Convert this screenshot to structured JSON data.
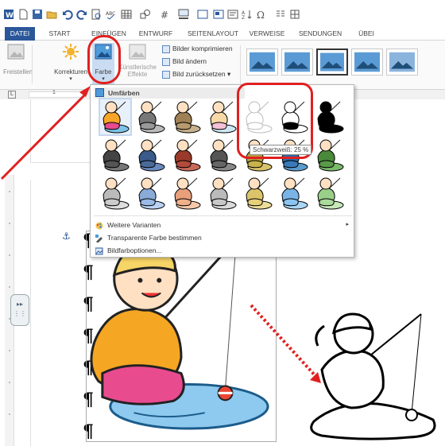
{
  "quick_access": {
    "icons": [
      "word-icon",
      "new-doc-icon",
      "save-icon",
      "open-icon",
      "undo-icon",
      "redo-icon",
      "print-preview-icon",
      "spelling-icon",
      "table-icon",
      "shapes-icon",
      "wordart-icon",
      "border-icon",
      "textbox-icon",
      "text-direction-icon",
      "sort-icon",
      "symbol-icon",
      "columns-icon",
      "position-icon"
    ]
  },
  "tabs": [
    {
      "label": "DATEI"
    },
    {
      "label": "START"
    },
    {
      "label": "EINFÜGEN"
    },
    {
      "label": "ENTWURF"
    },
    {
      "label": "SEITENLAYOUT"
    },
    {
      "label": "VERWEISE"
    },
    {
      "label": "SENDUNGEN"
    },
    {
      "label": "ÜBEI"
    }
  ],
  "ribbon": {
    "freistellen": "Freistellen",
    "korrekturen": "Korrekturen",
    "farbe": "Farbe",
    "kuenstlerische": "Künstlerische",
    "effekte": "Effekte",
    "bilder_komprimieren": "Bilder komprimieren",
    "bild_aendern": "Bild ändern",
    "bild_zuruecksetzen": "Bild zurücksetzen"
  },
  "ruler": {
    "tick_1": "1"
  },
  "dropdown": {
    "header": "Umfärben",
    "tooltip": "Schwarzweiß: 25 %",
    "menu": {
      "weitere": "Weitere Varianten",
      "transparente": "Transparente Farbe bestimmen",
      "optionen": "Bildfarboptionen..."
    },
    "rows": [
      [
        {
          "name": "original",
          "c1": "#f7a529",
          "c2": "#e84a8f",
          "c3": "#7fc2e8"
        },
        {
          "name": "grau",
          "c1": "#777",
          "c2": "#999",
          "c3": "#bbb"
        },
        {
          "name": "sepia",
          "c1": "#a08055",
          "c2": "#b89a70",
          "c3": "#c9b08c"
        },
        {
          "name": "washout",
          "c1": "#f7d9a8",
          "c2": "#f4c1d6",
          "c3": "#cfe7f4"
        },
        {
          "name": "schwarzweiss-25",
          "c1": "#fff",
          "c2": "#fff",
          "c3": "#fff"
        },
        {
          "name": "schwarzweiss-50",
          "c1": "#fff",
          "c2": "#000",
          "c3": "#fff"
        },
        {
          "name": "schwarzweiss-75",
          "c1": "#000",
          "c2": "#000",
          "c3": "#000"
        }
      ],
      [
        {
          "name": "dunkel-grau",
          "c1": "#444",
          "c2": "#555",
          "c3": "#777"
        },
        {
          "name": "dunkel-blau",
          "c1": "#3a5a8a",
          "c2": "#4a6a9a",
          "c3": "#6a8abd"
        },
        {
          "name": "dunkel-rot",
          "c1": "#9a3a2a",
          "c2": "#b44a3a",
          "c3": "#c76a5a"
        },
        {
          "name": "dunkel-grau2",
          "c1": "#555",
          "c2": "#666",
          "c3": "#888"
        },
        {
          "name": "dunkel-gold",
          "c1": "#b8a23a",
          "c2": "#c8b24a",
          "c3": "#d8c26a"
        },
        {
          "name": "dunkel-blau2",
          "c1": "#2a6aaa",
          "c2": "#3a7aba",
          "c3": "#5a9acd"
        },
        {
          "name": "dunkel-gruen",
          "c1": "#4a8a3a",
          "c2": "#5a9a4a",
          "c3": "#7aba6a"
        }
      ],
      [
        {
          "name": "hell-grau",
          "c1": "#bbb",
          "c2": "#ccc",
          "c3": "#ddd"
        },
        {
          "name": "hell-blau",
          "c1": "#8aaad8",
          "c2": "#9abae8",
          "c3": "#bad2f4"
        },
        {
          "name": "hell-orange",
          "c1": "#e8a07a",
          "c2": "#f0b08a",
          "c3": "#f6c8aa"
        },
        {
          "name": "hell-grau2",
          "c1": "#bbb",
          "c2": "#c8c8c8",
          "c3": "#dadada"
        },
        {
          "name": "hell-gold",
          "c1": "#dcc46a",
          "c2": "#e6d07a",
          "c3": "#eedd9a"
        },
        {
          "name": "hell-blau2",
          "c1": "#7ab4e6",
          "c2": "#8ac4f0",
          "c3": "#aad6f6"
        },
        {
          "name": "hell-gruen",
          "c1": "#9acf8a",
          "c2": "#aadb9a",
          "c3": "#c6e8ba"
        }
      ]
    ]
  },
  "doc": {
    "pilcrow": "¶"
  },
  "colors": {
    "accent": "#2b579a",
    "highlight_red": "#e02020",
    "tooltip_border": "#8a8a8a"
  }
}
